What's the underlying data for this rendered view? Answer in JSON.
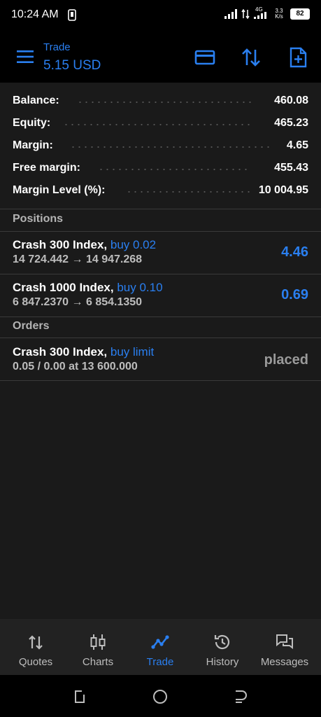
{
  "statusbar": {
    "time": "10:24 AM",
    "network": "4G",
    "speed": "3.3 K/s",
    "battery": "82"
  },
  "appbar": {
    "title": "Trade",
    "subtitle": "5.15 USD"
  },
  "summary": [
    {
      "label": "Balance:",
      "value": "460.08"
    },
    {
      "label": "Equity:",
      "value": "465.23"
    },
    {
      "label": "Margin:",
      "value": "4.65"
    },
    {
      "label": "Free margin:",
      "value": "455.43"
    },
    {
      "label": "Margin Level (%):",
      "value": "10 004.95"
    }
  ],
  "positions": {
    "header": "Positions",
    "items": [
      {
        "symbol": "Crash 300 Index,",
        "side": "buy 0.02",
        "prices": "14 724.442 → 14 947.268",
        "pnl": "4.46"
      },
      {
        "symbol": "Crash 1000 Index,",
        "side": "buy 0.10",
        "prices": "6 847.2370 → 6 854.1350",
        "pnl": "0.69"
      }
    ]
  },
  "orders": {
    "header": "Orders",
    "items": [
      {
        "symbol": "Crash 300 Index,",
        "side": "buy limit",
        "details": "0.05 / 0.00 at 13 600.000",
        "status": "placed"
      }
    ]
  },
  "nav": [
    {
      "label": "Quotes",
      "icon": "quotes-icon"
    },
    {
      "label": "Charts",
      "icon": "charts-icon"
    },
    {
      "label": "Trade",
      "icon": "trade-icon"
    },
    {
      "label": "History",
      "icon": "history-icon"
    },
    {
      "label": "Messages",
      "icon": "messages-icon"
    }
  ],
  "colors": {
    "accent": "#2a7ff0",
    "background": "#1a1a1a",
    "appbar": "#000000"
  }
}
